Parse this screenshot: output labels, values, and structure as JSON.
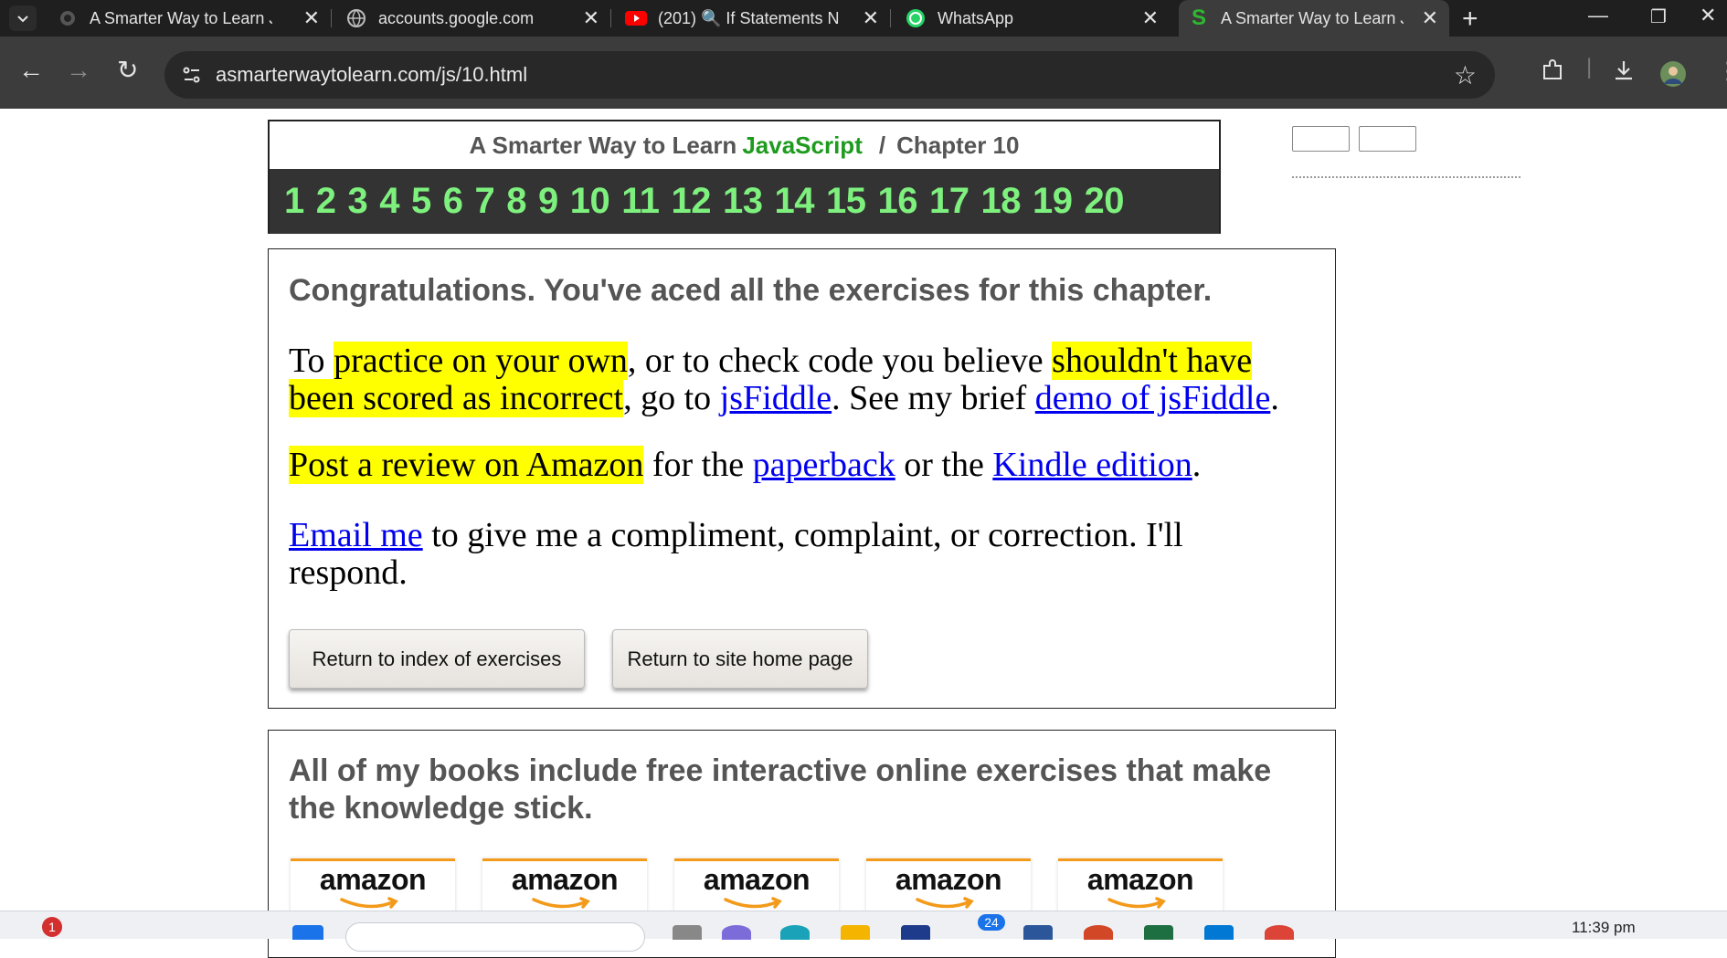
{
  "browser": {
    "tabs": [
      {
        "title": "A Smarter Way to Learn J",
        "icon": "shield-favicon-icon"
      },
      {
        "title": "accounts.google.com",
        "icon": "globe-icon"
      },
      {
        "title": "(201) 🔍 If Statements N",
        "icon": "youtube-icon"
      },
      {
        "title": "WhatsApp",
        "icon": "whatsapp-icon"
      },
      {
        "title": "A Smarter Way to Learn J",
        "icon": "smarter-way-s-icon"
      }
    ],
    "url": "asmarterwaytolearn.com/js/10.html"
  },
  "header": {
    "prefix": "A Smarter Way to Learn",
    "brand": "JavaScript",
    "separator": "/",
    "chapter": "Chapter 10",
    "chapter_links": [
      "1",
      "2",
      "3",
      "4",
      "5",
      "6",
      "7",
      "8",
      "9",
      "10",
      "11",
      "12",
      "13",
      "14",
      "15",
      "16",
      "17",
      "18",
      "19",
      "20"
    ]
  },
  "main": {
    "congrats": "Congratulations. You've aced all the exercises for this chapter.",
    "p1": {
      "t1": "To ",
      "h1": "practice on your own",
      "t2": ", or to check code you believe ",
      "h2": "shouldn't have been scored as incorrect",
      "t3": ", go to ",
      "link1": "jsFiddle",
      "t4": ". See my brief ",
      "link2": "demo of jsFiddle",
      "t5": "."
    },
    "p2": {
      "h1": "Post a review on Amazon",
      "t1": " for the ",
      "link1": "paperback",
      "t2": " or the ",
      "link2": "Kindle edition",
      "t3": "."
    },
    "p3": {
      "link1": "Email me",
      "t1": " to give me a compliment, complaint, or correction. I'll respond."
    },
    "buttons": {
      "index": "Return to index of exercises",
      "home": "Return to site home page"
    }
  },
  "books": {
    "text": "All of my books include free interactive online exercises that make the knowledge stick.",
    "amazon_label": "amazon"
  },
  "taskbar": {
    "time": "11:39 pm",
    "notif_badge": "1",
    "app_badge": "24"
  }
}
